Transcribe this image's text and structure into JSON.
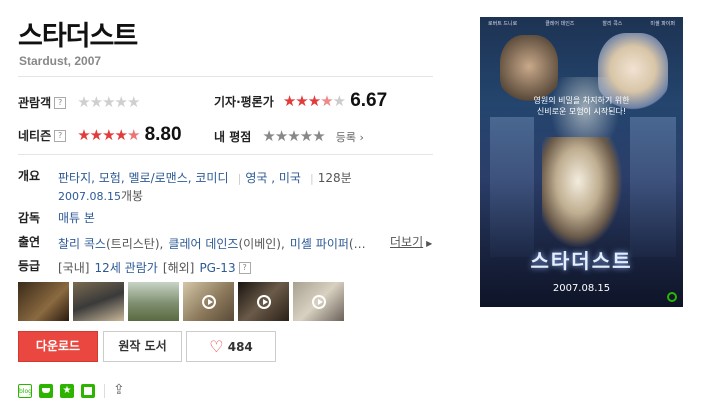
{
  "movie": {
    "title": "스타더스트",
    "subtitle": "Stardust, 2007"
  },
  "ratings": {
    "audience_label": "관람객",
    "critic_label": "기자·평론가",
    "critic_score": "6.67",
    "netizen_label": "네티즌",
    "netizen_score": "8.80",
    "my_label": "내 평점",
    "register_label": "등록"
  },
  "info": {
    "overview_label": "개요",
    "genres": [
      "판타지",
      "모험",
      "멜로/로맨스",
      "코미디"
    ],
    "countries": "영국 , 미국",
    "runtime": "128분",
    "release_date": "2007.08.15",
    "release_suffix": "개봉",
    "director_label": "감독",
    "director": "매튜 본",
    "cast_label": "출연",
    "cast_1_name": "찰리 콕스",
    "cast_1_role": "(트리스탄),",
    "cast_2_name": "클레어 데인즈",
    "cast_2_role": "(이베인),",
    "cast_3_name": "미셸 파이퍼",
    "cast_more": "(…",
    "more_label": "더보기",
    "grade_label": "등급",
    "grade_domestic_tag": "[국내]",
    "grade_domestic": "12세 관람가",
    "grade_foreign_tag": "[해외]",
    "grade_foreign": "PG-13"
  },
  "buttons": {
    "download": "다운로드",
    "original_book": "원작 도서",
    "like_count": "484"
  },
  "poster": {
    "title": "스타더스트",
    "tagline_1": "영원의 비밀을 차지하기 위한",
    "tagline_2": "신비로운 모험이 시작된다!",
    "date": "2007.08.15",
    "cast_names": [
      "로버트 드니로",
      "클레어 데인즈",
      "찰리 콕스",
      "미셸 파이퍼"
    ]
  },
  "colors": {
    "download_bg": "#e9473f",
    "star_red": "#e13b3b",
    "link": "#2d5a96"
  }
}
